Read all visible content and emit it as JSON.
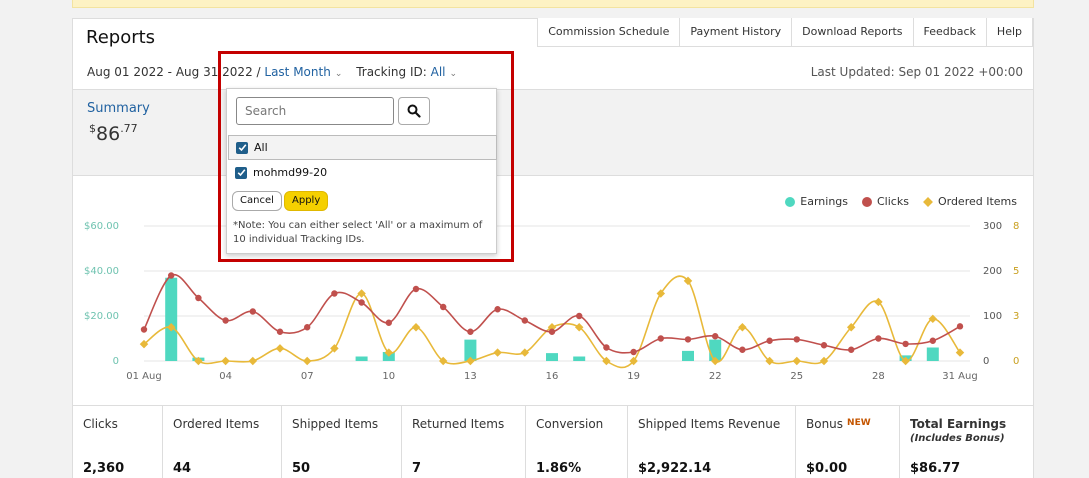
{
  "header": {
    "title": "Reports"
  },
  "tabs": [
    "Commission Schedule",
    "Payment History",
    "Download Reports",
    "Feedback",
    "Help"
  ],
  "date_range": {
    "range": "Aug 01 2022 - Aug 31 2022 /",
    "period": "Last Month",
    "tracking_label": "Tracking ID:",
    "tracking_value": "All"
  },
  "last_updated": "Last Updated: Sep 01 2022 +00:00",
  "summary": {
    "label": "Summary",
    "currency": "$",
    "whole": "86",
    "fraction": ".77"
  },
  "dropdown": {
    "search_placeholder": "Search",
    "options": [
      {
        "label": "All",
        "checked": true
      },
      {
        "label": "mohmd99-20",
        "checked": true
      }
    ],
    "cancel_label": "Cancel",
    "apply_label": "Apply",
    "note": "*Note: You can either select 'All' or a maximum of 10 individual Tracking IDs."
  },
  "legend": [
    {
      "label": "Earnings",
      "color": "#4fd8c0"
    },
    {
      "label": "Clicks",
      "color": "#c0504d"
    },
    {
      "label": "Ordered Items",
      "color": "#e8b93a"
    }
  ],
  "chart_data": {
    "type": "line",
    "x": [
      "01 Aug",
      "02",
      "03",
      "04",
      "05",
      "06",
      "07",
      "08",
      "09",
      "10",
      "11",
      "12",
      "13",
      "14",
      "15",
      "16",
      "17",
      "18",
      "19",
      "20",
      "21",
      "22",
      "23",
      "24",
      "25",
      "26",
      "27",
      "28",
      "29",
      "30",
      "31 Aug"
    ],
    "x_tick_labels": [
      "01 Aug",
      "04",
      "07",
      "10",
      "13",
      "16",
      "19",
      "22",
      "25",
      "28",
      "31 Aug"
    ],
    "y_left_ticks": [
      "$60.00",
      "$40.00",
      "$20.00",
      "0"
    ],
    "y_left_range": [
      0,
      60
    ],
    "y_clicks_ticks": [
      "300",
      "200",
      "100",
      "0"
    ],
    "y_clicks_range": [
      0,
      300
    ],
    "y_items_ticks": [
      "8",
      "5",
      "3",
      "0"
    ],
    "y_items_range": [
      0,
      8
    ],
    "series": [
      {
        "name": "Earnings",
        "type": "bar",
        "color": "#4fd8c0",
        "values": [
          0,
          37,
          1.5,
          0,
          0,
          0,
          0,
          0,
          2,
          4,
          0,
          0,
          9.5,
          0,
          0,
          3.5,
          2,
          0,
          0,
          0,
          4.5,
          9.5,
          0,
          0,
          0,
          0,
          0,
          0,
          2.5,
          6,
          0
        ]
      },
      {
        "name": "Clicks",
        "type": "line",
        "color": "#c0504d",
        "values": [
          70,
          190,
          140,
          90,
          110,
          65,
          75,
          150,
          130,
          85,
          160,
          120,
          65,
          115,
          90,
          65,
          100,
          30,
          20,
          50,
          48,
          55,
          25,
          45,
          48,
          35,
          25,
          50,
          38,
          45,
          77
        ]
      },
      {
        "name": "Ordered Items",
        "type": "line",
        "color": "#e8b93a",
        "values": [
          1,
          2,
          0,
          0,
          0,
          0.75,
          0,
          0.75,
          4,
          0.5,
          2,
          0,
          0,
          0.5,
          0.5,
          2,
          2,
          0,
          0,
          4,
          4.75,
          0,
          2,
          0,
          0,
          0,
          2,
          3.5,
          0,
          2.5,
          0.5
        ]
      }
    ]
  },
  "stats": [
    {
      "label": "Clicks",
      "value": "2,360"
    },
    {
      "label": "Ordered Items",
      "value": "44"
    },
    {
      "label": "Shipped Items",
      "value": "50"
    },
    {
      "label": "Returned Items",
      "value": "7"
    },
    {
      "label": "Conversion",
      "value": "1.86%"
    },
    {
      "label": "Shipped Items Revenue",
      "value": "$2,922.14"
    },
    {
      "label": "Bonus",
      "badge": "NEW",
      "value": "$0.00"
    },
    {
      "label": "Total Earnings",
      "sub": "(Includes Bonus)",
      "value": "$86.77"
    }
  ]
}
